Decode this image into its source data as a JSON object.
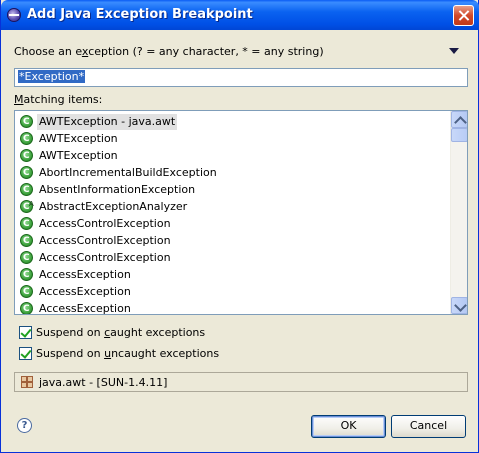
{
  "window": {
    "title": "Add Java Exception Breakpoint"
  },
  "prompt": {
    "before": "Choose an e",
    "mnemonic": "x",
    "after": "ception (? = any character, * = any string)"
  },
  "filter": {
    "value": "*Exception*"
  },
  "matching": {
    "before": "",
    "mnemonic": "M",
    "after": "atching items:"
  },
  "items": [
    {
      "label": "AWTException - java.awt",
      "icon": "class-icon"
    },
    {
      "label": "AWTException",
      "icon": "class-icon"
    },
    {
      "label": "AWTException",
      "icon": "class-icon"
    },
    {
      "label": "AbortIncrementalBuildException",
      "icon": "class-icon"
    },
    {
      "label": "AbsentInformationException",
      "icon": "class-icon"
    },
    {
      "label": "AbstractExceptionAnalyzer",
      "icon": "abstract-class-icon"
    },
    {
      "label": "AccessControlException",
      "icon": "class-icon"
    },
    {
      "label": "AccessControlException",
      "icon": "class-icon"
    },
    {
      "label": "AccessControlException",
      "icon": "class-icon"
    },
    {
      "label": "AccessException",
      "icon": "class-icon"
    },
    {
      "label": "AccessException",
      "icon": "class-icon"
    },
    {
      "label": "AccessException",
      "icon": "class-icon"
    }
  ],
  "caught": {
    "before": "Suspend on ",
    "mnemonic": "c",
    "after": "aught exceptions",
    "checked": true
  },
  "uncaught": {
    "before": "Suspend on ",
    "mnemonic": "u",
    "after": "ncaught exceptions",
    "checked": true
  },
  "status": {
    "text": "java.awt - [SUN-1.4.11]",
    "icon": "package-icon"
  },
  "buttons": {
    "ok": "OK",
    "cancel": "Cancel"
  },
  "colors": {
    "titlebar": "#0055e5",
    "selection": "#316ac5",
    "check": "#21a121"
  }
}
